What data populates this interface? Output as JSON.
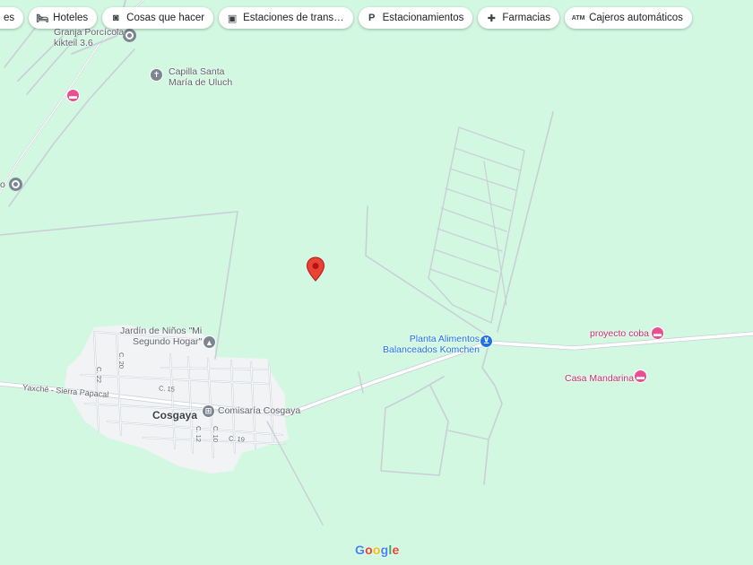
{
  "chips": [
    {
      "label": "es",
      "icon": "none"
    },
    {
      "label": "Hoteles",
      "icon": "bed-icon"
    },
    {
      "label": "Cosas que hacer",
      "icon": "camera-icon"
    },
    {
      "label": "Estaciones de trans…",
      "icon": "bus-icon"
    },
    {
      "label": "Estacionamientos",
      "icon": "parking-icon"
    },
    {
      "label": "Farmacias",
      "icon": "pharmacy-icon"
    },
    {
      "label": "Cajeros automáticos",
      "icon": "atm-icon"
    }
  ],
  "places": {
    "granja": {
      "line1": "Granja Porcícola",
      "line2": "kikteil 3.6"
    },
    "capilla": {
      "line1": "Capilla Santa",
      "line2": "María de Uluch"
    },
    "jardin": {
      "line1": "Jardín de Niños \"Mi",
      "line2": "Segundo Hogar\""
    },
    "comisaria": "Comisaría Cosgaya",
    "planta": {
      "line1": "Planta Alimentos",
      "line2": "Balanceados Komchen"
    },
    "proyecto": "proyecto coba",
    "casa": "Casa Mandarina",
    "partial": "o"
  },
  "town": "Cosgaya",
  "roads": {
    "main": "Yaxché - Sierra Papacal"
  },
  "streets": {
    "c22": "C. 22",
    "c20": "C. 20",
    "c15": "C. 15",
    "c12": "C. 12",
    "c10": "C. 10",
    "c19": "C. 19"
  },
  "logo": "Google",
  "colors": {
    "background": "#d3f8e2",
    "road": "#ffffff",
    "town_area": "#f1f3f4",
    "marker": "#ea4335",
    "hotel_poi": "#e94f91",
    "shop_poi": "#1a73e8"
  },
  "icons": {
    "marker": "red-location-pin-icon",
    "church": "cross-icon",
    "school": "graduation-cap-icon",
    "police": "police-badge-icon",
    "store": "shopping-cart-icon",
    "hotel": "bed-icon"
  }
}
